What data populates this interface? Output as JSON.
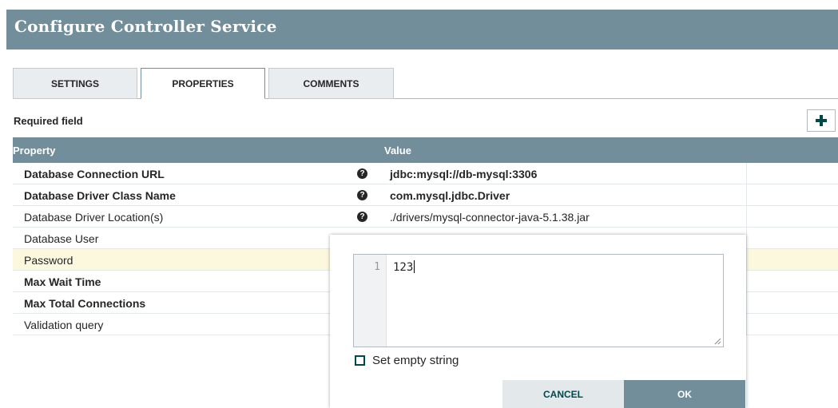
{
  "dialog": {
    "title": "Configure Controller Service"
  },
  "tabs": [
    {
      "label": "SETTINGS",
      "active": false
    },
    {
      "label": "PROPERTIES",
      "active": true
    },
    {
      "label": "COMMENTS",
      "active": false
    }
  ],
  "required_label": "Required field",
  "add_icon": "plus-icon",
  "table": {
    "headers": {
      "property": "Property",
      "value": "Value"
    },
    "rows": [
      {
        "name": "Database Connection URL",
        "required": true,
        "has_help": true,
        "value": "jdbc:mysql://db-mysql:3306"
      },
      {
        "name": "Database Driver Class Name",
        "required": true,
        "has_help": true,
        "value": "com.mysql.jdbc.Driver"
      },
      {
        "name": "Database Driver Location(s)",
        "required": false,
        "has_help": true,
        "value": "./drivers/mysql-connector-java-5.1.38.jar"
      },
      {
        "name": "Database User",
        "required": false,
        "has_help": false,
        "value": ""
      },
      {
        "name": "Password",
        "required": false,
        "has_help": false,
        "value": "",
        "selected": true
      },
      {
        "name": "Max Wait Time",
        "required": true,
        "has_help": false,
        "value": ""
      },
      {
        "name": "Max Total Connections",
        "required": true,
        "has_help": false,
        "value": ""
      },
      {
        "name": "Validation query",
        "required": false,
        "has_help": false,
        "value": ""
      }
    ]
  },
  "editor": {
    "line_number": "1",
    "text": "123",
    "set_empty_label": "Set empty string",
    "set_empty_checked": false,
    "cancel_label": "CANCEL",
    "ok_label": "OK"
  },
  "colors": {
    "header": "#728e9b",
    "selected_row": "#fcf8dd",
    "accent": "#004849"
  }
}
